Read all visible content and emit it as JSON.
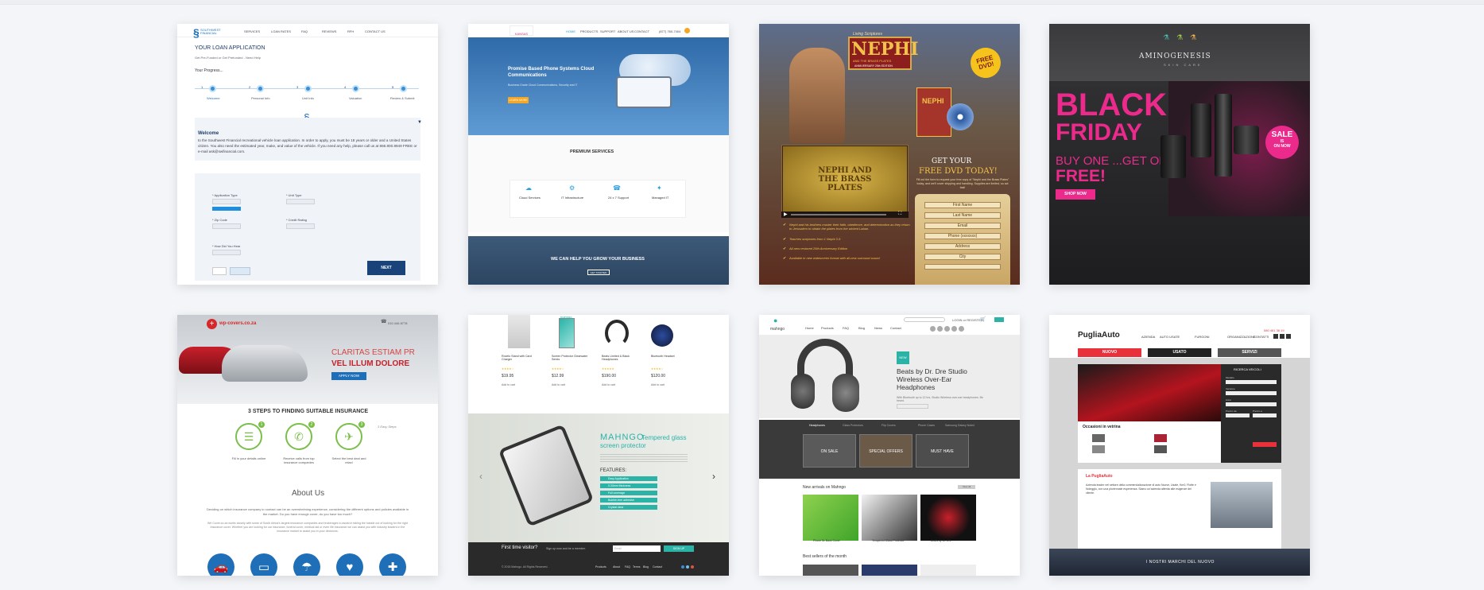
{
  "card1": {
    "brand": "SOUTHWEST FINANCIAL",
    "nav": [
      "SERVICES",
      "LOAN RATES",
      "FAQ",
      "REVIEWS",
      "RFH",
      "CONTACT US"
    ],
    "heading": "YOUR LOAN APPLICATION",
    "sub_text": "Get Pre-Funded or Get Prefunded - Need Help",
    "progress_label": "Your Progress...",
    "steps": [
      {
        "num": "1",
        "label": "Welcome"
      },
      {
        "num": "2",
        "label": "Personal Info"
      },
      {
        "num": "3",
        "label": "Unit Info"
      },
      {
        "num": "4",
        "label": "Valuation"
      },
      {
        "num": "5",
        "label": "Review & Submit"
      }
    ],
    "welcome_lead": "Welcome",
    "welcome_text": "to the Southwest Financial recreational vehicle loan application. In order to apply, you must be 18 years or older and a United States citizen. You also need the estimated year, make, and value of the vehicle. If you need any help, please call us at 866.800.8949 FREE or e-mail ask@swfinancial.com.",
    "field_labels": [
      "* Application Type",
      "* Unit Type",
      "* Zip Code",
      "* Credit Rating",
      "* How Did You Hear"
    ],
    "next_label": "NEXT"
  },
  "card2": {
    "logo": "KANSAS",
    "nav": [
      "HOME",
      "PRODUCTS",
      "SUPPORT",
      "ABOUT US",
      "CONTACT"
    ],
    "phone": "(877) 760-7404",
    "hero_title": "Promise Based Phone Systems Cloud Communications",
    "hero_text": "Business Grade Cloud Communications, Security and IT",
    "hero_btn": "LEARN MORE",
    "services_title": "PREMIUM SERVICES",
    "services": [
      "Cloud Services",
      "IT Infrastructure",
      "24 x 7 Support",
      "Managed IT"
    ],
    "banner_title": "WE CAN HELP YOU GROW YOUR BUSINESS",
    "banner_btn": "GET STARTED"
  },
  "card3": {
    "series": "Living Scriptures",
    "title": "NEPHI",
    "subtitle": "AND THE BRASS PLATES",
    "anniv": "ANNIVERSARY 25th EDITION",
    "badge": "FREE DVD!",
    "disc_label": "NEPHI",
    "plates_text": "NEPHI AND THE BRASS PLATES",
    "get_your": "GET YOUR",
    "free_dvd": "FREE DVD TODAY!",
    "promo_text": "Fill out the form to request your free copy of \"Nephi and the Brass Plates\" today, and we'll cover shipping and handling. Supplies are limited, so act fast!",
    "bullets": [
      "Nephi and his brothers muster their faith, obedience, and determination as they return to Jerusalem to obtain the plates from the wicked Laban.",
      "Teaches scriptures from 1 Nephi 3-5",
      "All-new restored 25th Anniversary Edition",
      "Available in new widescreen format with all-new surround sound"
    ],
    "form_fields": [
      "First Name",
      "Last Name",
      "Email",
      "Phone (xxxxxxx)",
      "Address",
      "City"
    ]
  },
  "card4": {
    "brand": "AMINOGENESIS",
    "tagline": "SKIN CARE",
    "headline1": "BLACK",
    "headline2": "FRIDAY",
    "offer1": "BUY ONE ...GET ONE",
    "offer2": "FREE!",
    "shop_btn": "SHOP NOW",
    "sale1": "SALE",
    "sale2": "IS",
    "sale3": "ON NOW",
    "colors": {
      "pink": "#ec2a8c",
      "dark": "#1d1d1f"
    }
  },
  "card5": {
    "logo": "wp-covers.co.za",
    "phone": "010 446 8778",
    "hero_line1": "CLARITAS ESTIAM PR",
    "hero_line2": "VEL ILLUM DOLORE",
    "hero_btn": "APPLY NOW",
    "steps_title": "3 STEPS TO FINDING SUITABLE INSURANCE",
    "steps": [
      {
        "num": "1",
        "label": "Fill in your details online"
      },
      {
        "num": "2",
        "label": "Receive calls from top insurance companies"
      },
      {
        "num": "3",
        "label": "Select the best deal and relax!"
      }
    ],
    "steps_note": "3 Easy Steps",
    "about_title": "About Us",
    "about_text": "Deciding on which insurance company to contact can be an overwhelming experience, considering the different options and policies available in the market. Do you have enough cover, do you have too much?",
    "about_text2": "We Cover.co.za works closely with some of South Africa's largest insurance companies and brokerages to assist in taking the hassle out of looking for the right insurance cover. Whether you are looking for car insurance, funeral cover, medical aid or even life insurance we can assist you with industry leaders in the insurance market to assist you in your decisions."
  },
  "card6": {
    "products": [
      {
        "name": "Rovelo Stand with Card Charger",
        "price": "$19.95"
      },
      {
        "name": "Screen Protector Clearwater Series",
        "price": "$12.99"
      },
      {
        "name": "Beats Limited & Black Headphones",
        "price": "$190.00"
      },
      {
        "name": "Bluetooth Headset",
        "price": "$120.00"
      }
    ],
    "add_to_cart": "Add to cart",
    "feature_brand": "MAHNGO",
    "feature_title": "Tempered glass screen protector",
    "features_label": "FEATURES:",
    "features": [
      "Easy Application",
      "0.33mm thickness",
      "Full coverage",
      "Bubble-free adhesive",
      "Crystal clear"
    ],
    "newsletter_label": "First time visitor?",
    "newsletter_text": "Sign up now and be a member.",
    "newsletter_placeholder": "Email",
    "newsletter_btn": "SIGN UP",
    "copyright": "© 2015 Mahngo. All Rights Reserved.",
    "footer_links": [
      "Products",
      "About",
      "FAQ",
      "Terms",
      "Blog",
      "Contact"
    ]
  },
  "card7": {
    "logo": "mahngo",
    "nav": [
      "Home",
      "Products",
      "FAQ",
      "Blog",
      "News",
      "Contact"
    ],
    "account": "LOGIN or REGISTER",
    "tag": "NEW",
    "product_title": "Beats by Dr. Dre Studio Wireless Over-Ear Headphones",
    "product_text": "With Bluetooth up to 12 hrs, Studio Wireless over-ear headphones. Be heard.",
    "tabs": [
      "Headphones",
      "Glass Protectors",
      "Flip Covers",
      "Phone Cases",
      "Samsung Galaxy Note4"
    ],
    "promos": [
      "ON SALE",
      "SPECIAL OFFERS",
      "MUST HAVE"
    ],
    "new_arrivals": "New arrivals on Mahngo",
    "view_all": "View all",
    "arrivals": [
      "Phone 5c Back Cover",
      "Tempered Glass Protector",
      "Beats by Dr. Dre"
    ],
    "best_sellers": "Best sellers of the month"
  },
  "card8": {
    "logo": "PugliaAuto",
    "nav": [
      "AZIENDA",
      "AUTO USATE",
      "FURGONI",
      "ORGANIZZAZIONE",
      "CONTATTI"
    ],
    "phone": "080 461 36 19",
    "tabs": [
      "NUOVO",
      "USATO",
      "SERVIZI"
    ],
    "search_title": "RICERCA VEICOLI",
    "search_fields": [
      "Modello",
      "Versione",
      "Anno",
      "Prezzo da",
      "Prezzo a"
    ],
    "showcase_title": "Occasioni in vetrina",
    "about_title": "La PugliaAuto",
    "about_text": "Azienda leader nel settore della commercializzazione di auto Nuove, Usate, Km0, Flotte e Noleggio, con una pluriennale esperienza. Siamo un'azienda attenta alle esigenze del cliente.",
    "footer": "I NOSTRI MARCHI DEL NUOVO",
    "colors": {
      "red": "#e8313b"
    }
  }
}
